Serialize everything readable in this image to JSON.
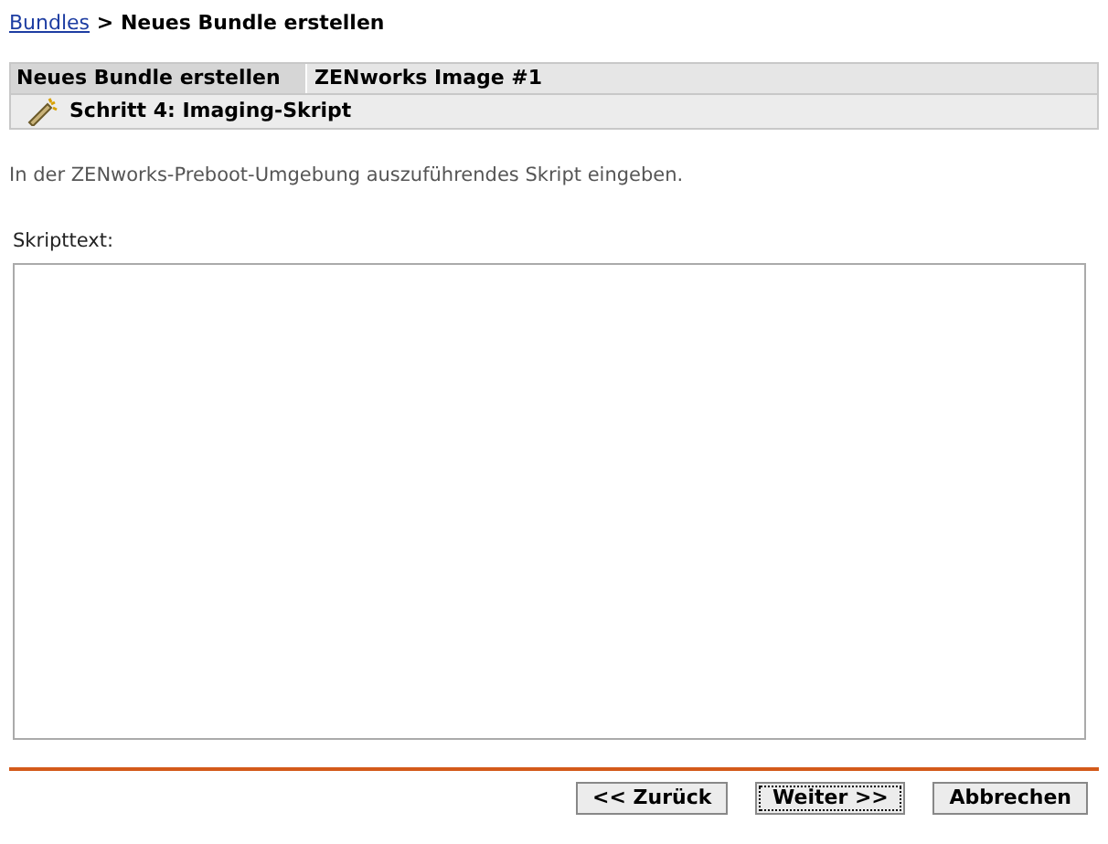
{
  "breadcrumb": {
    "link": "Bundles",
    "separator": ">",
    "current": "Neues Bundle erstellen"
  },
  "header": {
    "title": "Neues Bundle erstellen",
    "value": "ZENworks Image #1"
  },
  "step": {
    "title": "Schritt 4: Imaging-Skript"
  },
  "description": "In der ZENworks-Preboot-Umgebung auszuführendes Skript eingeben.",
  "script_field": {
    "label": "Skripttext:"
  },
  "buttons": [
    {
      "label": "<< Zurück",
      "focused": false
    },
    {
      "label": "Weiter >>",
      "focused": true
    },
    {
      "label": "Abbrechen",
      "focused": false
    }
  ]
}
